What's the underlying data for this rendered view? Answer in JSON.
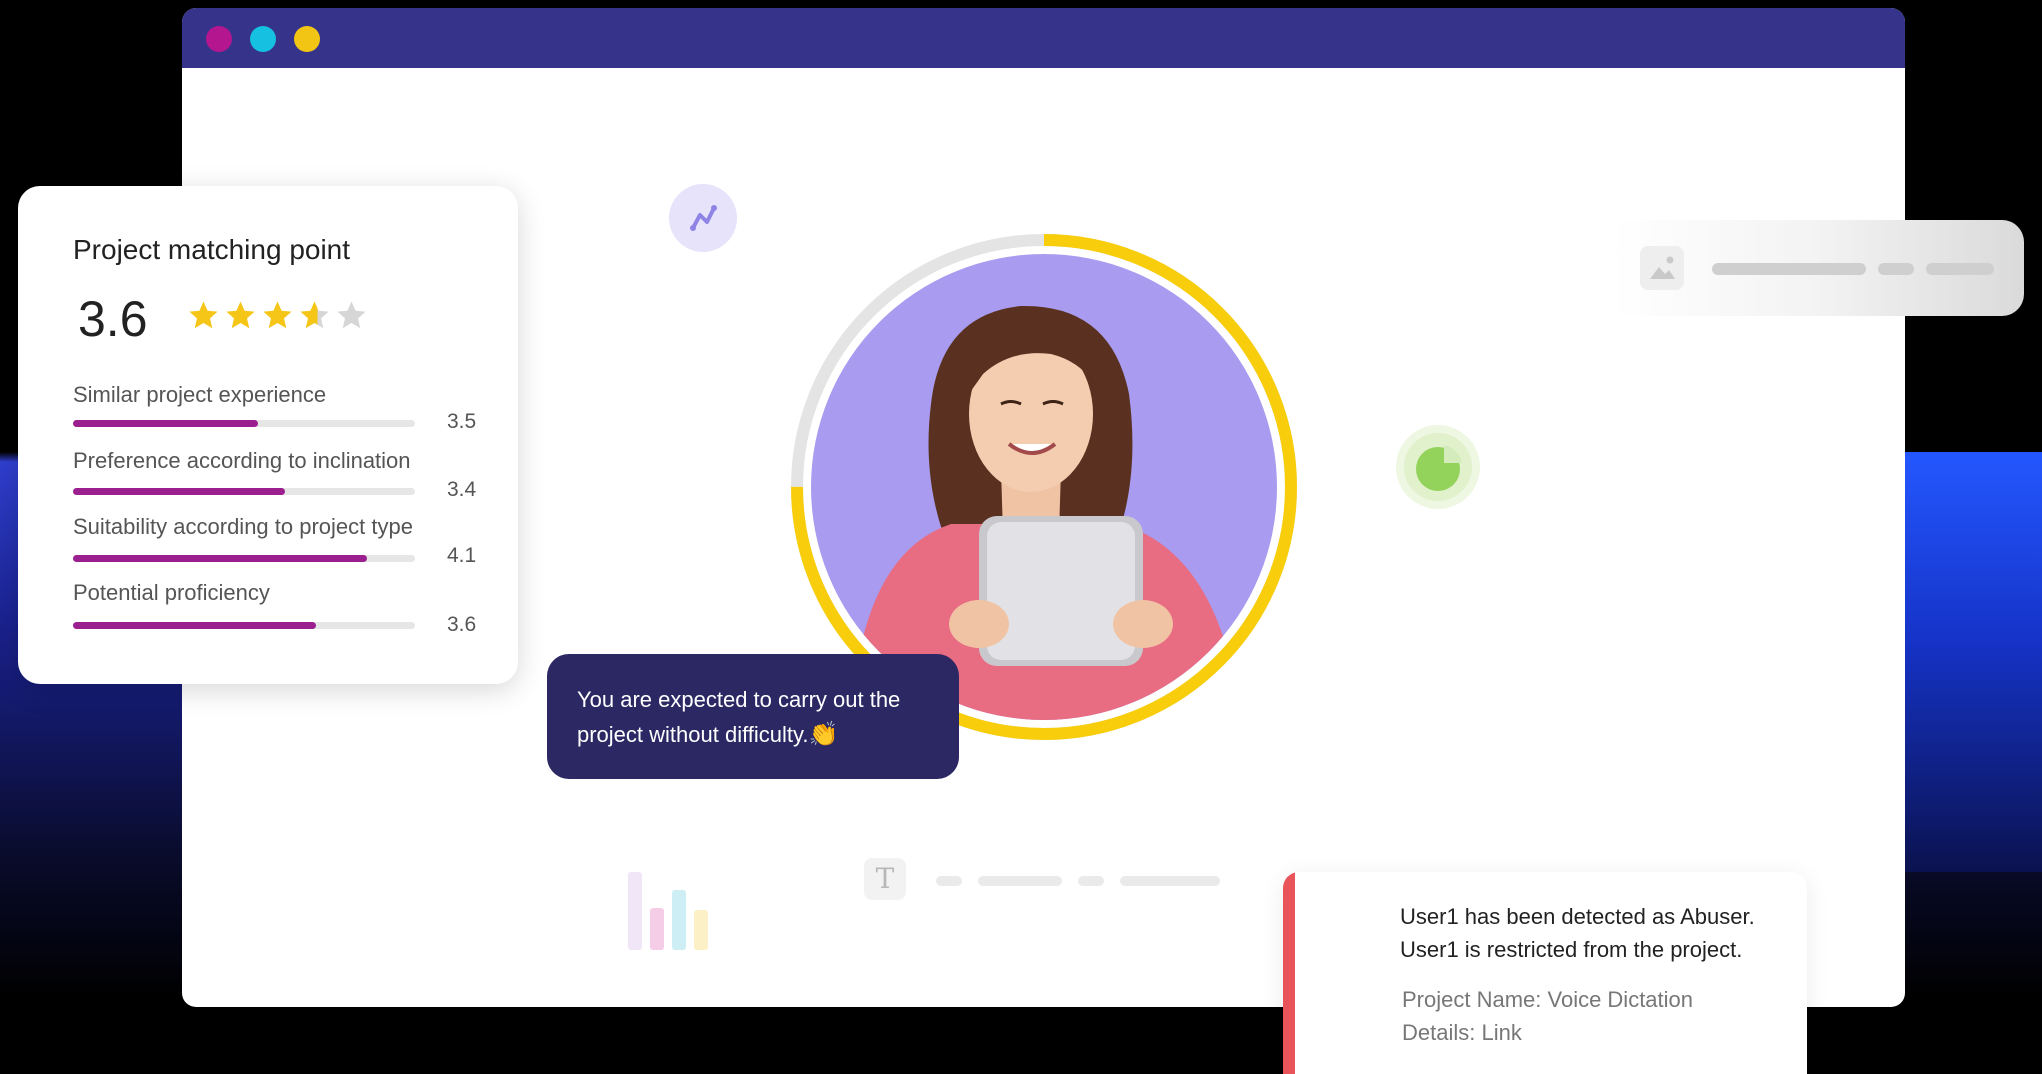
{
  "window": {
    "controls": [
      {
        "name": "close",
        "color": "#b3168f"
      },
      {
        "name": "minimize",
        "color": "#15c0e0"
      },
      {
        "name": "maximize",
        "color": "#f2c514"
      }
    ]
  },
  "score_card": {
    "title": "Project matching point",
    "score": "3.6",
    "rating": 3.6,
    "rating_max": 5,
    "metrics": [
      {
        "label": "Similar project experience",
        "value": "3.5",
        "fraction": 0.54
      },
      {
        "label": "Preference according to inclination",
        "value": "3.4",
        "fraction": 0.62
      },
      {
        "label": "Suitability according to project type",
        "value": "4.1",
        "fraction": 0.86
      },
      {
        "label": "Potential proficiency",
        "value": "3.6",
        "fraction": 0.71
      }
    ],
    "colors": {
      "bar_fill": "#9b1f8f",
      "star": "#f5c518",
      "star_empty": "#d6d6d6"
    }
  },
  "avatar": {
    "progress": 0.75,
    "ring_color": "#f7cd0c",
    "track_color": "#e4e4e4",
    "background": "#a99cf0"
  },
  "bubble": {
    "text": "You are expected to carry out the project without difficulty.",
    "emoji": "👏"
  },
  "alert": {
    "line1": "User1 has been detected as Abuser.",
    "line2": "User1 is restricted from the project.",
    "project_label": "Project Name: Voice Dictation",
    "details_label": "Details: Link",
    "accent": "#e8545a"
  },
  "icons": {
    "chart_chip": "trend-line-icon",
    "green_chip": "pie-chart-icon",
    "media_card": "image-icon",
    "text_placeholder": "text-format-icon",
    "bars": "bar-chart-icon"
  }
}
